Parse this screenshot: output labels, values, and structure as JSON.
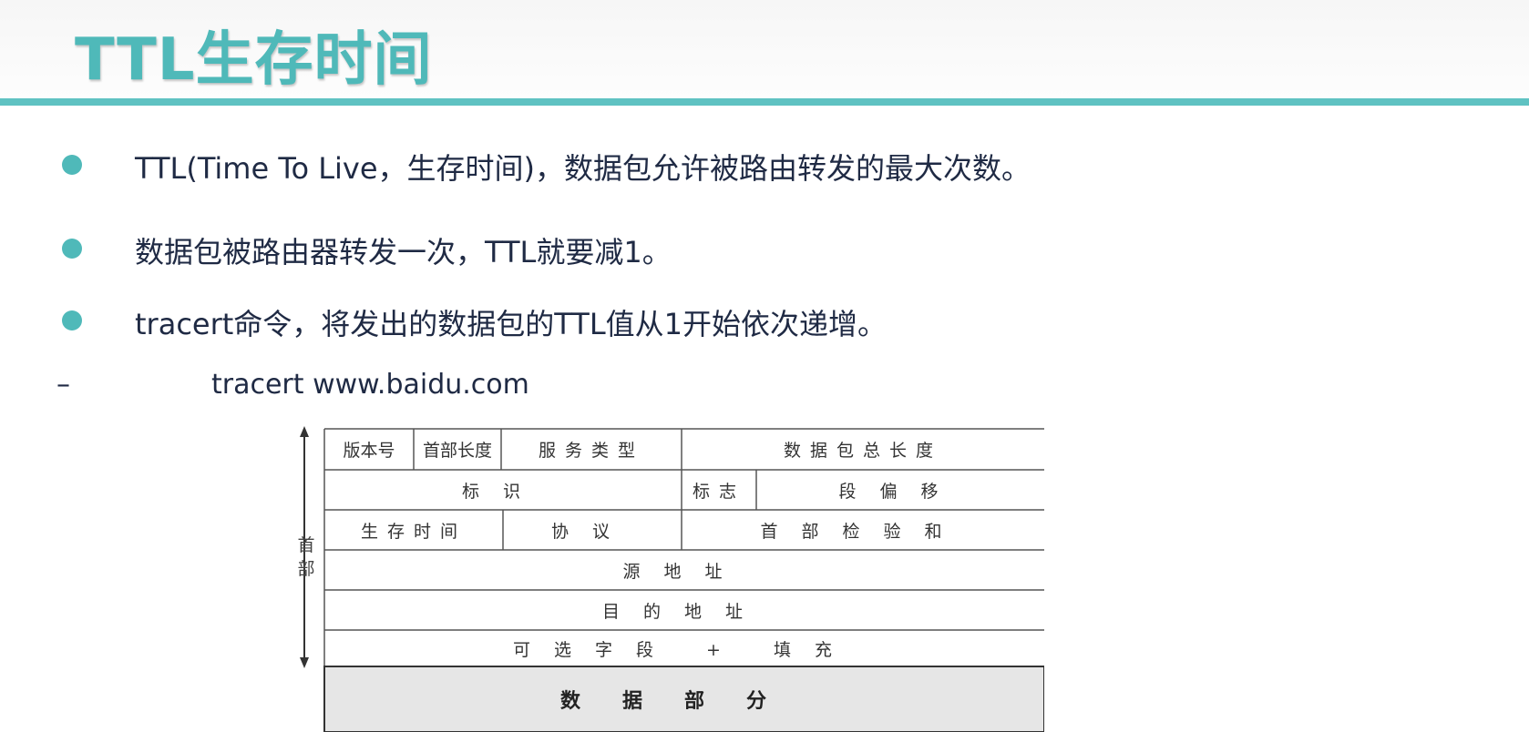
{
  "title": "TTL生存时间",
  "bullets": [
    "TTL(Time To Live，生存时间)，数据包允许被路由转发的最大次数。",
    "数据包被路由器转发一次，TTL就要减1。",
    "tracert命令，将发出的数据包的TTL值从1开始依次递增。"
  ],
  "sub_item": {
    "marker": "–",
    "text": "tracert www.baidu.com"
  },
  "diagram": {
    "side_label": "首部",
    "row1": {
      "version": "版本号",
      "header_length": "首部长度",
      "service_type": "服务类型",
      "total_length": "数据包总长度"
    },
    "row2": {
      "identification": "标识",
      "flags": "标志",
      "fragment_offset": "段偏移"
    },
    "row3": {
      "ttl": "生存时间",
      "protocol": "协议",
      "header_checksum": "首部检验和"
    },
    "row4": {
      "source_address": "源地址"
    },
    "row5": {
      "destination_address": "目的地址"
    },
    "row6": {
      "options": "可选字段 + 填充"
    },
    "row7": {
      "data": "数据部分"
    }
  },
  "colors": {
    "accent": "#4fb9b9",
    "text": "#1f2a44"
  }
}
